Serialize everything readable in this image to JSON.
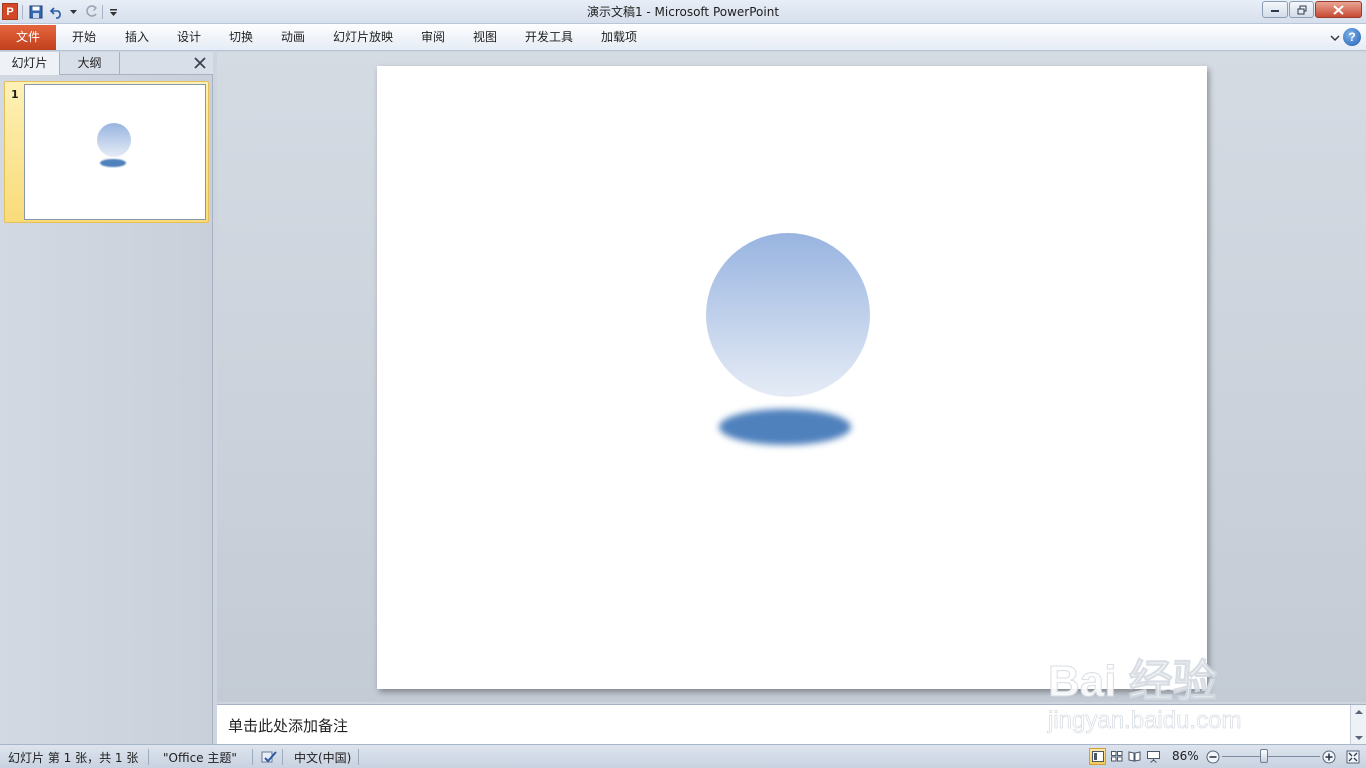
{
  "window": {
    "title": "演示文稿1  -  Microsoft PowerPoint",
    "app_icon_letter": "P"
  },
  "qat": {
    "items": [
      "save-icon",
      "undo-icon",
      "redo-icon",
      "customize-qat-icon"
    ]
  },
  "ribbon": {
    "file_tab": "文件",
    "tabs": [
      "开始",
      "插入",
      "设计",
      "切换",
      "动画",
      "幻灯片放映",
      "审阅",
      "视图",
      "开发工具",
      "加载项"
    ],
    "help_label": "?"
  },
  "left_pane": {
    "tabs": [
      "幻灯片",
      "大纲"
    ],
    "active_tab": "幻灯片",
    "slides": [
      {
        "number": "1"
      }
    ]
  },
  "notes": {
    "placeholder": "单击此处添加备注"
  },
  "statusbar": {
    "slide_info": "幻灯片 第 1 张，共 1 张",
    "theme": "\"Office 主题\"",
    "language": "中文(中国)",
    "zoom": "86%"
  },
  "watermark": {
    "brand": "Bai  经验",
    "url": "jingyan.baidu.com"
  },
  "colors": {
    "file_tab": "#d24726",
    "sphere_top": "#98b4e0",
    "sphere_bottom": "#e6ecf6",
    "shadow": "#4f81bd"
  }
}
